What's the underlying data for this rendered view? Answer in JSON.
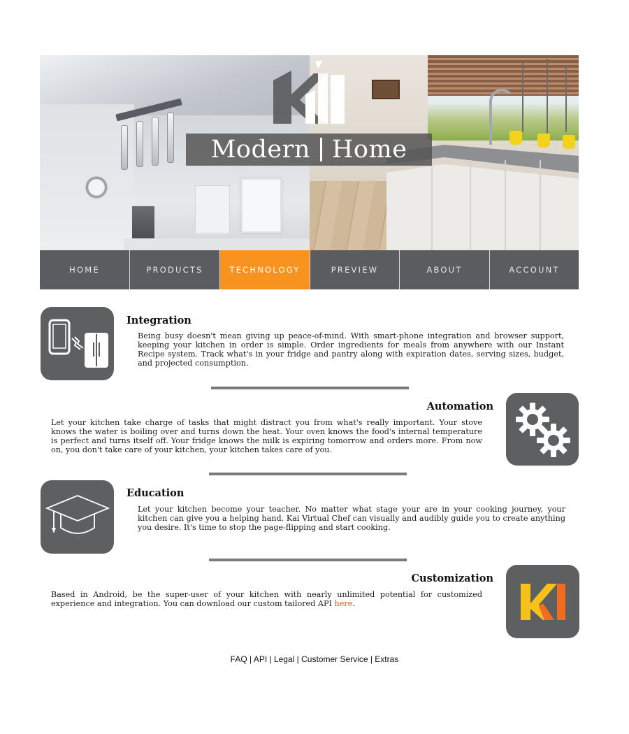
{
  "hero": {
    "title_left": "Modern",
    "title_right": "Home",
    "logo_icon": "ki-logo-icon"
  },
  "nav": {
    "items": [
      {
        "label": "HOME",
        "active": false
      },
      {
        "label": "PRODUCTS",
        "active": false
      },
      {
        "label": "TECHNOLOGY",
        "active": true
      },
      {
        "label": "PREVIEW",
        "active": false
      },
      {
        "label": "ABOUT",
        "active": false
      },
      {
        "label": "ACCOUNT",
        "active": false
      }
    ],
    "active_color": "#f7931e",
    "bar_color": "#5b5c5f"
  },
  "features": [
    {
      "title": "Integration",
      "icon": "phone-fridge-icon",
      "body": "Being busy doesn't mean giving up peace-of-mind. With smart-phone integration and browser support, keeping your kitchen in order is simple. Order ingredients for meals from anywhere with our Instant Recipe system. Track what's in your fridge and pantry along with expiration dates, serving sizes, budget, and projected consumption."
    },
    {
      "title": "Automation",
      "icon": "gears-icon",
      "body": "Let your kitchen take charge of tasks that might distract you from what's really important. Your stove knows the water is boiling over and turns down the heat. Your oven knows the food's internal temperature is perfect and turns itself off. Your fridge knows the milk is expiring tomorrow and orders more. From now on, you don't take care of your kitchen, your kitchen takes care of you."
    },
    {
      "title": "Education",
      "icon": "graduation-cap-icon",
      "body": "Let your kitchen become your teacher. No matter what stage your are in your cooking journey, your kitchen can give you a helping hand. Kai Virtual Chef can visually and audibly guide you to create anything you desire. It's time to stop the page-flipping and start cooking."
    },
    {
      "title": "Customization",
      "icon": "ki-app-icon",
      "body_before": "Based in Android, be the super-user of your kitchen with nearly unlimited potential for customized experience and integration. You can download our custom tailored API ",
      "link": "here",
      "body_after": "."
    }
  ],
  "footer": {
    "links": [
      "FAQ",
      "API",
      "Legal",
      "Customer Service",
      "Extras"
    ],
    "separator": " | "
  },
  "colors": {
    "tile": "#5e5f61",
    "divider": "#7a7a7a",
    "link": "#e4551a",
    "logo_yellow": "#f5c11a",
    "logo_orange": "#f26b21"
  }
}
